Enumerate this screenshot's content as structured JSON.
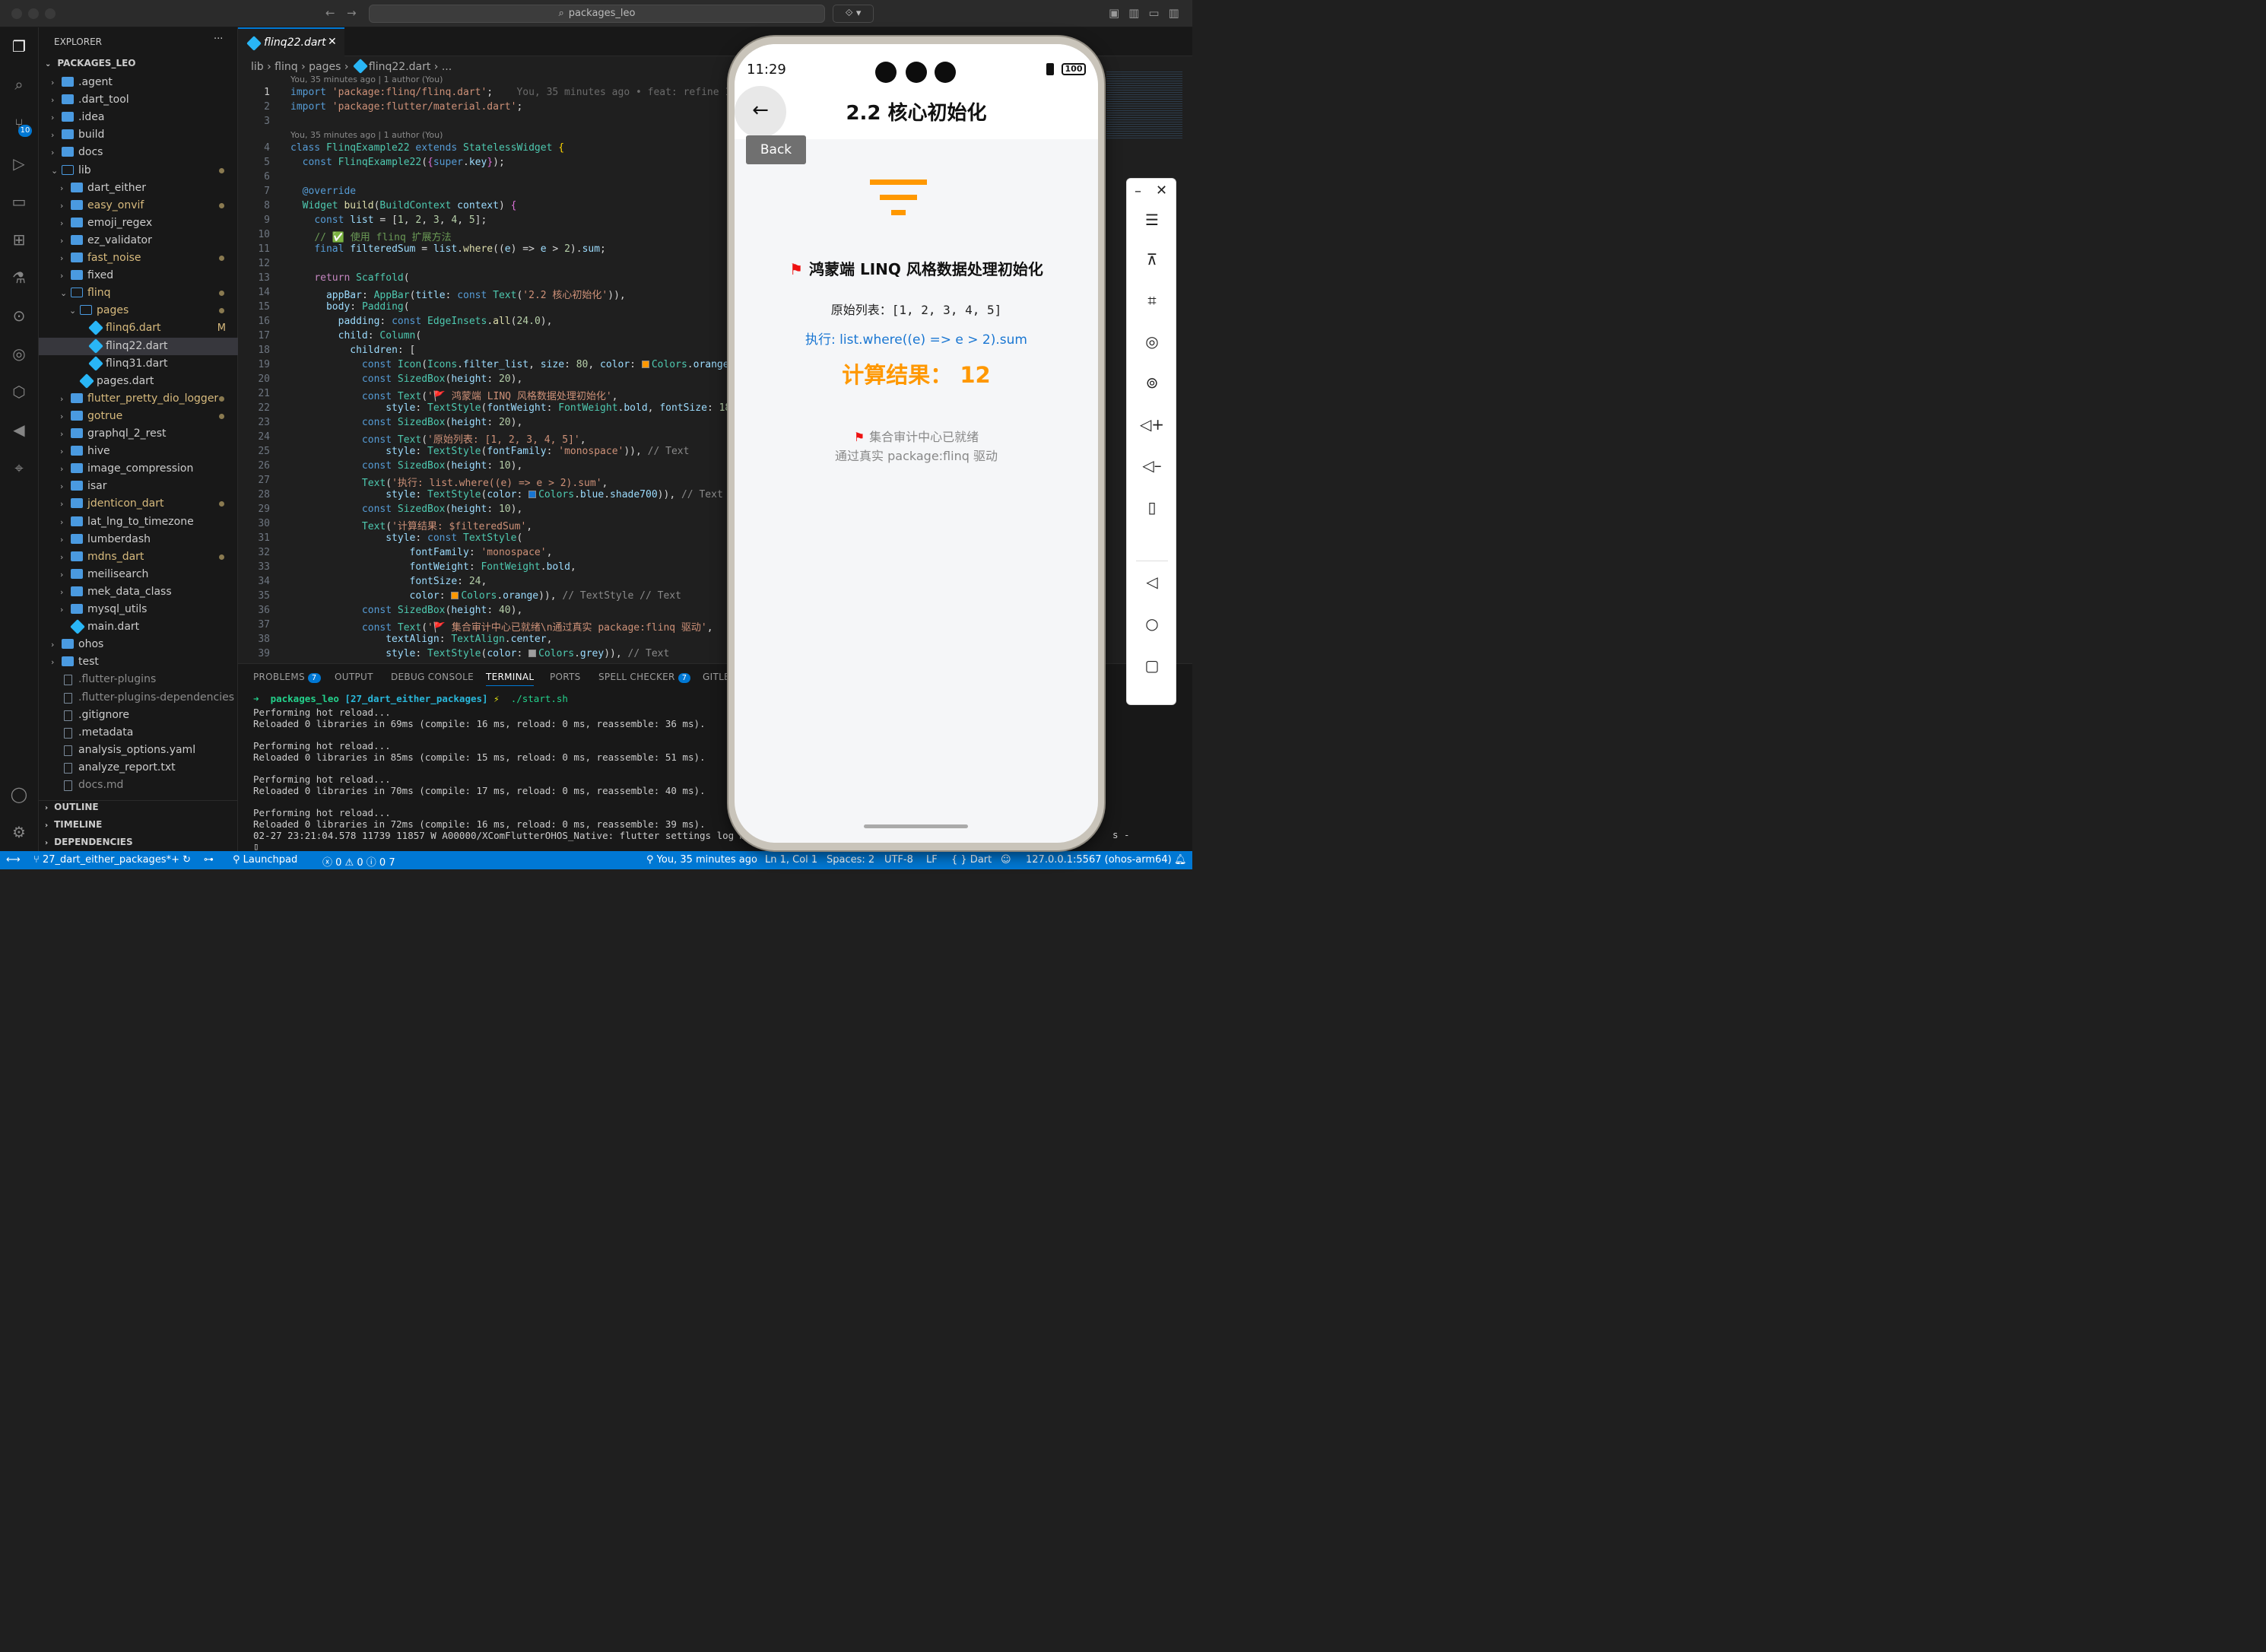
{
  "window": {
    "search": "packages_leo"
  },
  "explorer": {
    "title": "EXPLORER",
    "root": "PACKAGES_LEO",
    "items": [
      {
        "label": ".agent",
        "kind": "folder",
        "level": 1,
        "open": false
      },
      {
        "label": ".dart_tool",
        "kind": "folder",
        "level": 1,
        "open": false
      },
      {
        "label": ".idea",
        "kind": "folder",
        "level": 1,
        "open": false
      },
      {
        "label": "build",
        "kind": "folder",
        "level": 1,
        "open": false
      },
      {
        "label": "docs",
        "kind": "folder",
        "level": 1,
        "open": false
      },
      {
        "label": "lib",
        "kind": "folder",
        "level": 1,
        "open": true,
        "dot": true
      },
      {
        "label": "dart_either",
        "kind": "folder",
        "level": 2,
        "open": false
      },
      {
        "label": "easy_onvif",
        "kind": "folder",
        "level": 2,
        "open": false,
        "modified": true,
        "dot": true
      },
      {
        "label": "emoji_regex",
        "kind": "folder",
        "level": 2,
        "open": false
      },
      {
        "label": "ez_validator",
        "kind": "folder",
        "level": 2,
        "open": false
      },
      {
        "label": "fast_noise",
        "kind": "folder",
        "level": 2,
        "open": false,
        "modified": true,
        "dot": true
      },
      {
        "label": "fixed",
        "kind": "folder",
        "level": 2,
        "open": false
      },
      {
        "label": "flinq",
        "kind": "folder",
        "level": 2,
        "open": true,
        "modified": true,
        "dot": true
      },
      {
        "label": "pages",
        "kind": "folder",
        "level": 3,
        "open": true,
        "modified": true,
        "dot": true
      },
      {
        "label": "flinq6.dart",
        "kind": "dart",
        "level": 4,
        "modified": true,
        "flag": "M"
      },
      {
        "label": "flinq22.dart",
        "kind": "dart",
        "level": 4,
        "selected": true
      },
      {
        "label": "flinq31.dart",
        "kind": "dart",
        "level": 4
      },
      {
        "label": "pages.dart",
        "kind": "dart",
        "level": 3
      },
      {
        "label": "flutter_pretty_dio_logger",
        "kind": "folder",
        "level": 2,
        "open": false,
        "modified": true,
        "dot": true
      },
      {
        "label": "gotrue",
        "kind": "folder",
        "level": 2,
        "open": false,
        "modified": true,
        "dot": true
      },
      {
        "label": "graphql_2_rest",
        "kind": "folder",
        "level": 2,
        "open": false
      },
      {
        "label": "hive",
        "kind": "folder",
        "level": 2,
        "open": false
      },
      {
        "label": "image_compression",
        "kind": "folder",
        "level": 2,
        "open": false
      },
      {
        "label": "isar",
        "kind": "folder",
        "level": 2,
        "open": false
      },
      {
        "label": "jdenticon_dart",
        "kind": "folder",
        "level": 2,
        "open": false,
        "modified": true,
        "dot": true
      },
      {
        "label": "lat_lng_to_timezone",
        "kind": "folder",
        "level": 2,
        "open": false
      },
      {
        "label": "lumberdash",
        "kind": "folder",
        "level": 2,
        "open": false
      },
      {
        "label": "mdns_dart",
        "kind": "folder",
        "level": 2,
        "open": false,
        "modified": true,
        "dot": true
      },
      {
        "label": "meilisearch",
        "kind": "folder",
        "level": 2,
        "open": false
      },
      {
        "label": "mek_data_class",
        "kind": "folder",
        "level": 2,
        "open": false
      },
      {
        "label": "mysql_utils",
        "kind": "folder",
        "level": 2,
        "open": false
      },
      {
        "label": "main.dart",
        "kind": "dart",
        "level": 2
      },
      {
        "label": "ohos",
        "kind": "folder",
        "level": 1,
        "open": false
      },
      {
        "label": "test",
        "kind": "folder",
        "level": 1,
        "open": false
      },
      {
        "label": ".flutter-plugins",
        "kind": "file",
        "level": 1,
        "dim": true
      },
      {
        "label": ".flutter-plugins-dependencies",
        "kind": "file",
        "level": 1,
        "dim": true
      },
      {
        "label": ".gitignore",
        "kind": "file",
        "level": 1
      },
      {
        "label": ".metadata",
        "kind": "file",
        "level": 1
      },
      {
        "label": "analysis_options.yaml",
        "kind": "file",
        "level": 1
      },
      {
        "label": "analyze_report.txt",
        "kind": "file",
        "level": 1
      },
      {
        "label": "docs.md",
        "kind": "file",
        "level": 1,
        "dim": true
      }
    ],
    "sections": [
      "OUTLINE",
      "TIMELINE",
      "DEPENDENCIES"
    ]
  },
  "editor": {
    "tab": "flinq22.dart",
    "breadcrumb": [
      "lib",
      "flinq",
      "pages",
      "flinq22.dart",
      "..."
    ],
    "blame_top": "You, 35 minutes ago | 1 author (You)",
    "inline_blame": "You, 35 minutes ago • feat: refine 1",
    "blame_class": "You, 35 minutes ago | 1 author (You)",
    "line_numbers": [
      "1",
      "2",
      "3",
      "4",
      "5",
      "6",
      "7",
      "8",
      "9",
      "10",
      "11",
      "12",
      "13",
      "14",
      "15",
      "16",
      "17",
      "18",
      "19",
      "20",
      "21",
      "22",
      "23",
      "24",
      "25",
      "26",
      "27",
      "28",
      "29",
      "30",
      "31",
      "32",
      "33",
      "34",
      "35",
      "36",
      "37",
      "38",
      "39"
    ]
  },
  "panel": {
    "tabs": [
      "PROBLEMS",
      "OUTPUT",
      "DEBUG CONSOLE",
      "TERMINAL",
      "PORTS",
      "SPELL CHECKER",
      "GITLE"
    ],
    "problems_count": "7",
    "spell_count": "7",
    "active": "TERMINAL",
    "prompt_dir": "packages_leo",
    "prompt_branch": "[27_dart_either_packages]",
    "prompt_sym": "⚡",
    "prompt_cmd": "./start.sh",
    "lines": [
      "Performing hot reload...",
      "Reloaded 0 libraries in 69ms (compile: 16 ms, reload: 0 ms, reassemble: 36 ms).",
      "",
      "Performing hot reload...",
      "Reloaded 0 libraries in 85ms (compile: 15 ms, reload: 0 ms, reassemble: 51 ms).",
      "",
      "Performing hot reload...",
      "Reloaded 0 libraries in 70ms (compile: 17 ms, reload: 0 ms, reassemble: 40 ms).",
      "",
      "Performing hot reload...",
      "Reloaded 0 libraries in 72ms (compile: 16 ms, reload: 0 ms, reassemble: 39 ms).",
      "02-27 23:21:04.578 11739 11857 W A00000/XComFlutterOHOS_Native: flutter settings log me",
      "s -"
    ]
  },
  "status": {
    "branch": "27_dart_either_packages*+",
    "launchpad": "Launchpad",
    "errors": "0",
    "warnings": "0",
    "info": "0",
    "info2": "7",
    "blame": "You, 35 minutes ago",
    "position": "Ln 1, Col 1",
    "spaces": "Spaces: 2",
    "encoding": "UTF-8",
    "eol": "LF",
    "lang": "{ } Dart",
    "device": "127.0.0.1:5567 (ohos-arm64)"
  },
  "phone": {
    "time": "11:29",
    "battery": "100",
    "title": "2.2 核心初始化",
    "back_tooltip": "Back",
    "heading": "鸿蒙端 LINQ 风格数据处理初始化",
    "original": "原始列表：[1, 2, 3, 4, 5]",
    "exec": "执行: list.where((e) => e > 2).sum",
    "result": "计算结果： 12",
    "footer1": "集合审计中心已就绪",
    "footer2": "通过真实 package:flinq 驱动",
    "accent": "#FF9800",
    "link": "#1976D2"
  },
  "colors": {
    "statusbar": "#0078d4",
    "editor_bg": "#1f1f1f",
    "sidebar_bg": "#181818"
  }
}
